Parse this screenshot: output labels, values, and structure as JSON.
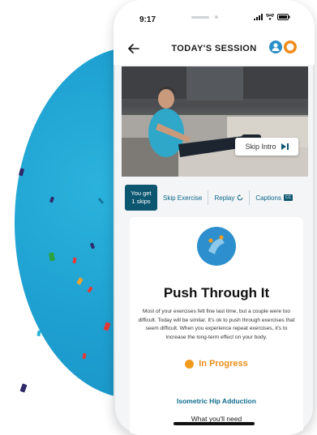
{
  "status_bar": {
    "time": "9:17"
  },
  "header": {
    "title": "TODAY'S SESSION",
    "back_icon": "arrow-left-icon"
  },
  "video": {
    "skip_intro_label": "Skip Intro"
  },
  "controls": {
    "skips_line1": "You get",
    "skips_line2": "1 skips",
    "skip_exercise": "Skip Exercise",
    "replay": "Replay",
    "captions": "Captions",
    "cc_badge": "CC"
  },
  "card": {
    "title": "Push Through It",
    "body": "Most of your exercises felt fine last time, but a couple were too difficult. Today will be similar. It's ok to push through exercises that seem difficult. When you experience repeat exercises, it's to increase the long-term effect on your body.",
    "status": "In Progress",
    "exercise_name": "Isometric Hip Adduction",
    "what_you_need": "What you'll need"
  },
  "colors": {
    "accent": "#0c5670",
    "blob": "#1d9fd0",
    "progress": "#f29a1e",
    "link": "#0f6c8c"
  }
}
